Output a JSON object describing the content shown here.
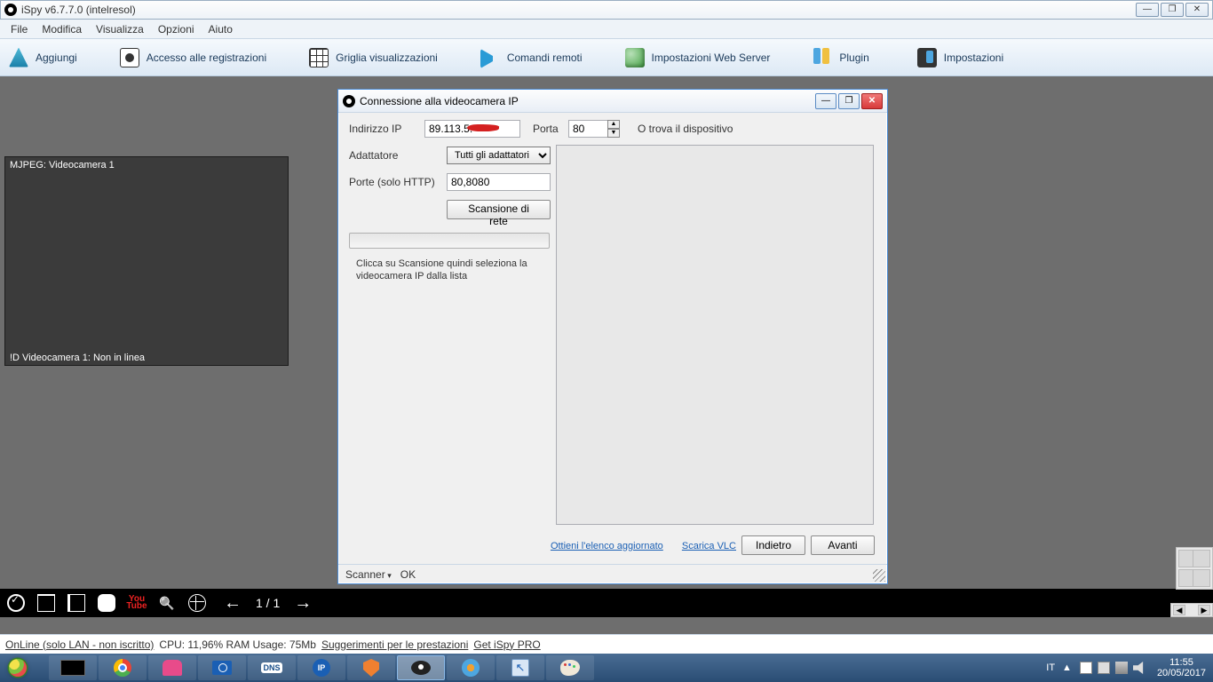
{
  "titlebar": {
    "title": "iSpy v6.7.7.0 (intelresol)"
  },
  "menubar": {
    "items": [
      "File",
      "Modifica",
      "Visualizza",
      "Opzioni",
      "Aiuto"
    ]
  },
  "toolbar": {
    "add": "Aggiungi",
    "recordings": "Accesso alle registrazioni",
    "grid": "Griglia visualizzazioni",
    "remote": "Comandi remoti",
    "webserver": "Impostazioni Web Server",
    "plugin": "Plugin",
    "settings": "Impostazioni"
  },
  "camera_tile": {
    "top": "MJPEG: Videocamera 1",
    "bottom": "!D  Videocamera 1: Non in linea"
  },
  "bottom_strip": {
    "counter": "1 / 1"
  },
  "statusbar": {
    "online": "OnLine (solo LAN - non iscritto)",
    "cpu_ram": "CPU: 11,96% RAM Usage: 75Mb",
    "perf": "Suggerimenti per le prestazioni",
    "pro": "Get iSpy PRO"
  },
  "dialog": {
    "title": "Connessione alla videocamera IP",
    "ip_label": "Indirizzo IP",
    "ip_value": "89.113.5.",
    "port_label": "Porta",
    "port_value": "80",
    "find_device": "O trova il dispositivo",
    "adapter_label": "Adattatore",
    "adapter_value": "Tutti gli adattatori",
    "ports_http_label": "Porte (solo HTTP)",
    "ports_http_value": "80,8080",
    "scan_button": "Scansione di rete",
    "hint": "Clicca su Scansione quindi seleziona la videocamera IP dalla lista",
    "link_update": "Ottieni l'elenco aggiornato",
    "link_vlc": "Scarica VLC",
    "btn_back": "Indietro",
    "btn_next": "Avanti",
    "status_scanner": "Scanner",
    "status_ok": "OK"
  },
  "taskbar": {
    "lang": "IT",
    "time": "11:55",
    "date": "20/05/2017"
  }
}
